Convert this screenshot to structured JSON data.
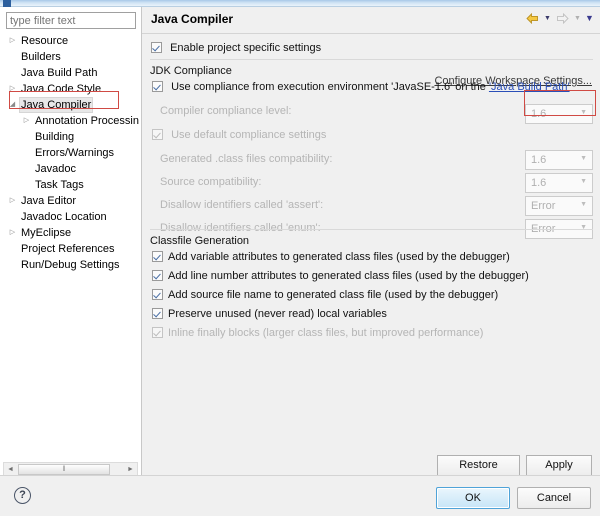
{
  "window": {
    "accent_color": "#a8c8e8"
  },
  "sidebar": {
    "filter": {
      "placeholder": "type filter text",
      "value": ""
    },
    "items": [
      {
        "label": "Resource",
        "indent": 1,
        "twisty": "collapsed",
        "selected": false
      },
      {
        "label": "Builders",
        "indent": 1,
        "twisty": "none",
        "selected": false
      },
      {
        "label": "Java Build Path",
        "indent": 1,
        "twisty": "none",
        "selected": false
      },
      {
        "label": "Java Code Style",
        "indent": 1,
        "twisty": "collapsed",
        "selected": false
      },
      {
        "label": "Java Compiler",
        "indent": 1,
        "twisty": "expanded",
        "selected": true
      },
      {
        "label": "Annotation Processin",
        "indent": 2,
        "twisty": "collapsed",
        "selected": false
      },
      {
        "label": "Building",
        "indent": 2,
        "twisty": "none",
        "selected": false
      },
      {
        "label": "Errors/Warnings",
        "indent": 2,
        "twisty": "none",
        "selected": false
      },
      {
        "label": "Javadoc",
        "indent": 2,
        "twisty": "none",
        "selected": false
      },
      {
        "label": "Task Tags",
        "indent": 2,
        "twisty": "none",
        "selected": false
      },
      {
        "label": "Java Editor",
        "indent": 1,
        "twisty": "collapsed",
        "selected": false
      },
      {
        "label": "Javadoc Location",
        "indent": 1,
        "twisty": "none",
        "selected": false
      },
      {
        "label": "MyEclipse",
        "indent": 1,
        "twisty": "collapsed",
        "selected": false
      },
      {
        "label": "Project References",
        "indent": 1,
        "twisty": "none",
        "selected": false
      },
      {
        "label": "Run/Debug Settings",
        "indent": 1,
        "twisty": "none",
        "selected": false
      }
    ],
    "scrollbar": {
      "left_arrow": "◄",
      "right_arrow": "►",
      "grip": "‖"
    }
  },
  "header": {
    "title": "Java Compiler",
    "back_arrow": "⇦",
    "forward_arrow": "⇨",
    "caret": "▼"
  },
  "enable_specific": {
    "label": "Enable project specific settings",
    "checked": true
  },
  "workspace_link": {
    "label": "Configure Workspace Settings..."
  },
  "jdk_compliance": {
    "title": "JDK Compliance",
    "use_execution_env": {
      "prefix": "Use compliance from execution environment 'JavaSE-1.6' on the ",
      "link": "'Java Build Path'",
      "checked": true
    },
    "compiler_compliance": {
      "label": "Compiler compliance level:",
      "value": "1.6",
      "enabled": false,
      "highlighted": true
    },
    "use_default_settings": {
      "label": "Use default compliance settings",
      "checked": true,
      "enabled": false
    },
    "fields": [
      {
        "label": "Generated .class files compatibility:",
        "value": "1.6",
        "enabled": false
      },
      {
        "label": "Source compatibility:",
        "value": "1.6",
        "enabled": false
      },
      {
        "label": "Disallow identifiers called 'assert':",
        "value": "Error",
        "enabled": false
      },
      {
        "label": "Disallow identifiers called 'enum':",
        "value": "Error",
        "enabled": false
      }
    ]
  },
  "classfile_generation": {
    "title": "Classfile Generation",
    "options": [
      {
        "label": "Add variable attributes to generated class files (used by the debugger)",
        "checked": true,
        "enabled": true
      },
      {
        "label": "Add line number attributes to generated class files (used by the debugger)",
        "checked": true,
        "enabled": true
      },
      {
        "label": "Add source file name to generated class file (used by the debugger)",
        "checked": true,
        "enabled": true
      },
      {
        "label": "Preserve unused (never read) local variables",
        "checked": true,
        "enabled": true
      },
      {
        "label": "Inline finally blocks (larger class files, but improved performance)",
        "checked": true,
        "enabled": false
      }
    ]
  },
  "page_buttons": {
    "restore_defaults": "Restore Defaults",
    "apply": "Apply"
  },
  "dialog_buttons": {
    "help": "?",
    "ok": "OK",
    "cancel": "Cancel"
  }
}
